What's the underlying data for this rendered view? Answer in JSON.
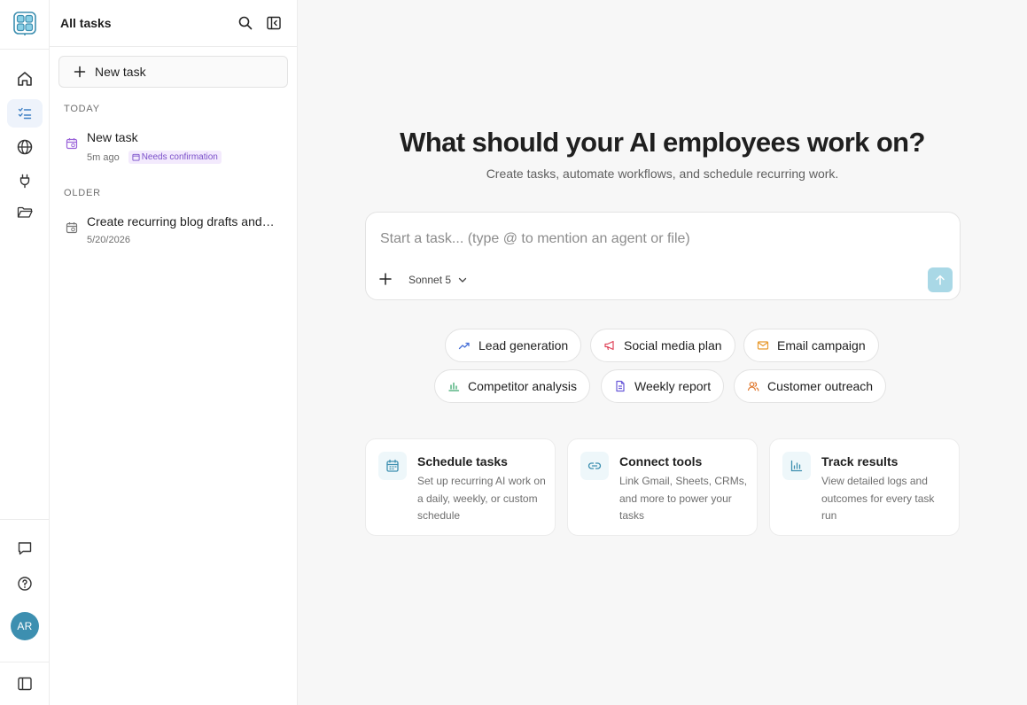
{
  "rail": {
    "avatar_initials": "AR",
    "active_item": "tasks"
  },
  "panel": {
    "title": "All tasks",
    "new_task_label": "New task",
    "sections": {
      "today": "TODAY",
      "older": "OLDER"
    },
    "tasks": [
      {
        "name": "New task",
        "meta": "5m ago",
        "badge": "Needs confirmation"
      },
      {
        "name": "Create recurring blog drafts and…",
        "meta": "5/20/2026"
      }
    ]
  },
  "main": {
    "headline": "What should your AI employees work on?",
    "subline": "Create tasks, automate workflows, and schedule recurring work.",
    "composer": {
      "placeholder": "Start a task... (type @ to mention an agent or file)",
      "value": "",
      "model": "Sonnet 5"
    },
    "suggestions": [
      {
        "label": "Lead generation",
        "icon": "trend-up-icon"
      },
      {
        "label": "Social media plan",
        "icon": "megaphone-icon"
      },
      {
        "label": "Email campaign",
        "icon": "mail-icon"
      },
      {
        "label": "Competitor analysis",
        "icon": "bar-chart-icon"
      },
      {
        "label": "Weekly report",
        "icon": "document-icon"
      },
      {
        "label": "Customer outreach",
        "icon": "users-icon"
      }
    ],
    "cards": [
      {
        "title": "Schedule tasks",
        "desc": "Set up recurring AI work on a daily, weekly, or custom schedule",
        "icon": "calendar-icon"
      },
      {
        "title": "Connect tools",
        "desc": "Link Gmail, Sheets, CRMs, and more to power your tasks",
        "icon": "link-icon"
      },
      {
        "title": "Track results",
        "desc": "View detailed logs and outcomes for every task run",
        "icon": "bar-chart-icon"
      }
    ]
  },
  "colors": {
    "accent": "#3d8fb0",
    "active_nav_bg": "#eef3fb",
    "badge_bg": "#f3eafd",
    "badge_text": "#7a4fc9",
    "send_button": "#a9d8e6"
  }
}
